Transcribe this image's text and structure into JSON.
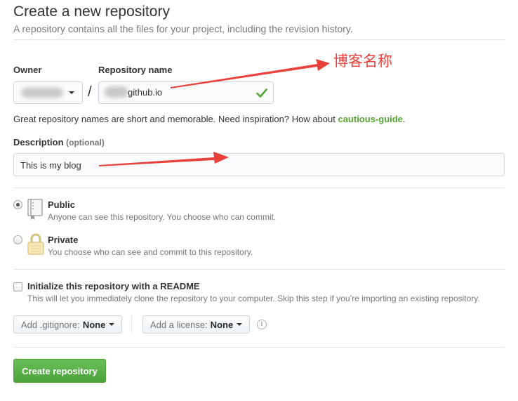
{
  "header": {
    "title": "Create a new repository",
    "subtitle": "A repository contains all the files for your project, including the revision history."
  },
  "owner": {
    "label": "Owner"
  },
  "repository": {
    "label": "Repository name",
    "separator": "/",
    "value_suffix": "github.io",
    "valid_icon": "check-icon"
  },
  "name_hint": {
    "prefix": "Great repository names are short and memorable. Need inspiration? How about ",
    "suggestion": "cautious-guide",
    "suffix": "."
  },
  "description": {
    "label": "Description",
    "optional": "(optional)",
    "value": "This is my blog"
  },
  "visibility": {
    "public": {
      "title": "Public",
      "note": "Anyone can see this repository. You choose who can commit.",
      "icon": "repo-book-icon",
      "selected": true
    },
    "private": {
      "title": "Private",
      "note": "You choose who can see and commit to this repository.",
      "icon": "lock-icon",
      "selected": false
    }
  },
  "readme": {
    "title": "Initialize this repository with a README",
    "note": "This will let you immediately clone the repository to your computer. Skip this step if you’re importing an existing repository.",
    "checked": false
  },
  "gitignore": {
    "prefix": "Add .gitignore:",
    "value": "None"
  },
  "license": {
    "prefix": "Add a license:",
    "value": "None"
  },
  "info_icon": "info-icon",
  "create_button": "Create repository",
  "annotations": {
    "repo_name_note": "博客名称",
    "arrow_color": "#e8413b"
  },
  "colors": {
    "accent_green": "#55a532",
    "button_green": "#5cb54b"
  }
}
